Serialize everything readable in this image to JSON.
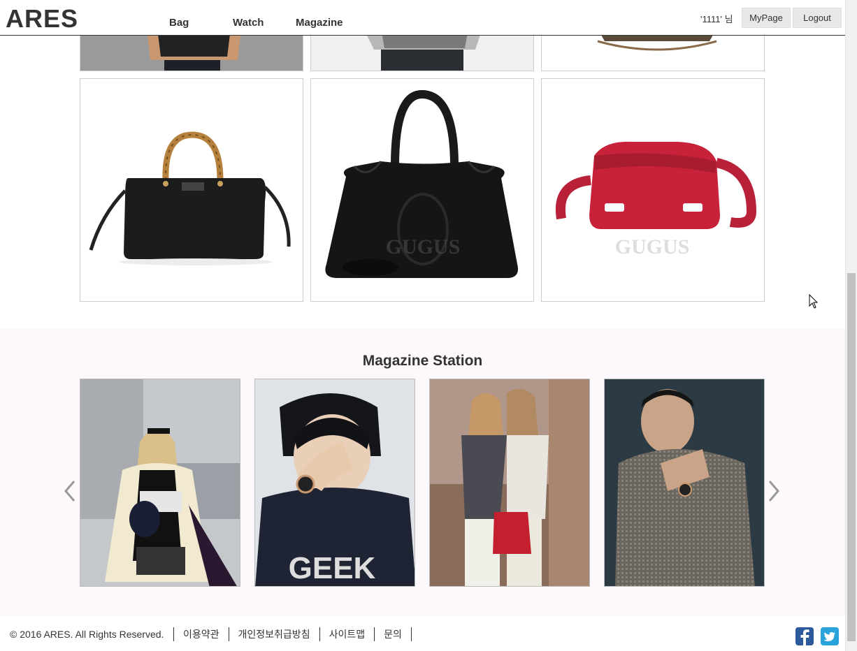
{
  "header": {
    "logo": "ARES",
    "nav": [
      "Bag",
      "Watch",
      "Magazine"
    ],
    "user_label": "'1111' 님",
    "mypage_label": "MyPage",
    "logout_label": "Logout"
  },
  "magazine": {
    "title": "Magazine Station",
    "watermarks": [
      "GEEK"
    ]
  },
  "products": {
    "watermark": "GUGUS"
  },
  "footer": {
    "copyright": "© 2016 ARES. All Rights Reserved.",
    "links": [
      "이용약관",
      "개인정보취급방침",
      "사이트맵",
      "문의"
    ]
  },
  "icons": {
    "prev": "chevron-left-icon",
    "next": "chevron-right-icon",
    "facebook": "facebook-icon",
    "twitter": "twitter-icon"
  },
  "colors": {
    "magazine_bg": "#fdf8fb",
    "facebook": "#2d5a9c",
    "twitter": "#2aa3dc"
  }
}
